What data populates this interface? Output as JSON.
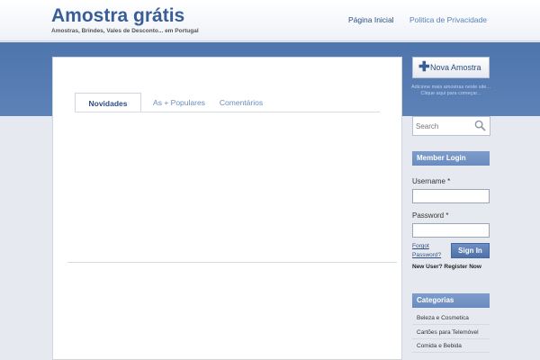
{
  "header": {
    "title": "Amostra grátis",
    "tagline": "Amostras, Brindes, Vales de Desconto... em Portugal",
    "nav": {
      "home": "Página Inicial",
      "privacy": "Politica de Privacidade"
    }
  },
  "content": {
    "tabs": {
      "novidades": "Novidades",
      "populares": "As + Populares",
      "comentarios": "Comentários"
    }
  },
  "sidebar": {
    "new_sample_button": "Nova Amostra",
    "new_sample_hint_1": "Adicione mais amostras neste site...",
    "new_sample_hint_2": "Clique aqui para começar...",
    "search": {
      "placeholder": "Search"
    },
    "login": {
      "heading": "Member Login",
      "username_label": "Username *",
      "password_label": "Password *",
      "forgot_1": "Forgot",
      "forgot_2": "Password?",
      "signin_button": "Sign In",
      "register": "New User? Register Now"
    },
    "categories": {
      "heading": "Categorias",
      "items": [
        "Beleza e Cosmetica",
        "Cartões para Telemóvel",
        "Comida e Bebida"
      ]
    }
  },
  "colors": {
    "accent": "#4f75ad",
    "link": "#2d4d80",
    "widget_head": "#7496c6"
  },
  "icons": {
    "plus": "plus-icon",
    "search": "search-icon"
  }
}
